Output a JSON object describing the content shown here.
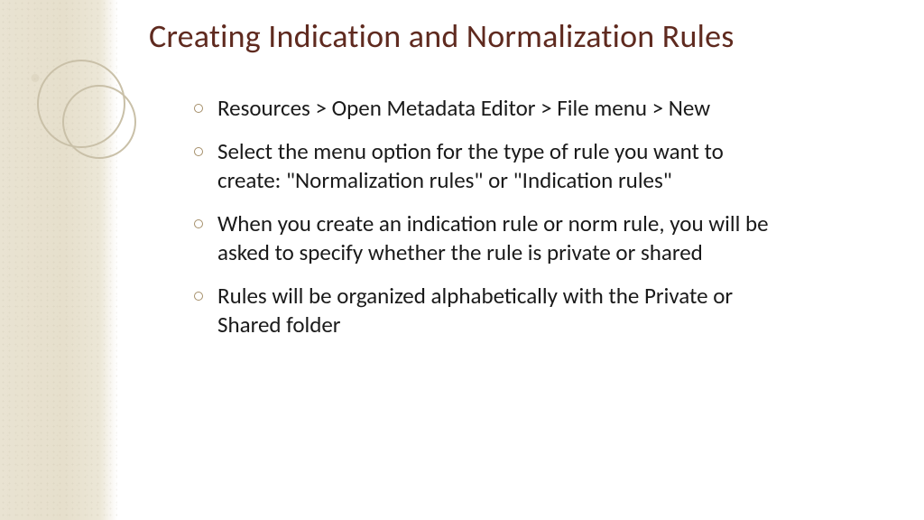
{
  "slide": {
    "title": "Creating Indication and Normalization Rules",
    "bullets": [
      "Resources > Open Metadata Editor > File menu > New",
      "Select the menu option for the type of rule you want to create: \"Normalization rules\" or \"Indication rules\"",
      "When you create an indication rule or norm rule, you will be asked to specify whether the rule is private or shared",
      "Rules will be organized alphabetically with the Private or Shared folder"
    ]
  }
}
